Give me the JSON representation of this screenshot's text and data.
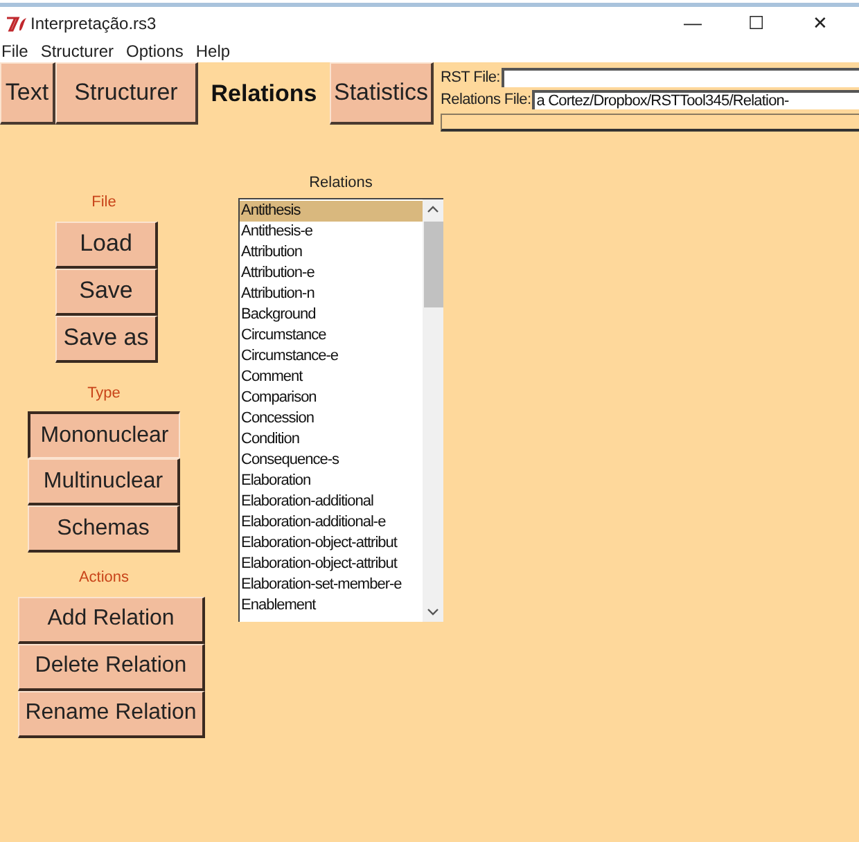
{
  "window": {
    "title": "Interpretação.rs3",
    "controls": [
      "—",
      "☐",
      "✕"
    ]
  },
  "menu": [
    "File",
    "Structurer",
    "Options",
    "Help"
  ],
  "tabs": [
    {
      "label": "Text",
      "selected": false
    },
    {
      "label": "Structurer",
      "selected": false
    },
    {
      "label": "Relations",
      "selected": true
    },
    {
      "label": "Statistics",
      "selected": false
    }
  ],
  "files": [
    {
      "label": "RST File:"
    },
    {
      "label": "Relations File:",
      "value": "a Cortez/Dropbox/RSTTool345/Relation-"
    }
  ],
  "groups": [
    {
      "title": "File",
      "buttons": [
        {
          "label": "Load",
          "selected": false
        },
        {
          "label": "Save",
          "selected": false
        },
        {
          "label": "Save as",
          "selected": false
        }
      ]
    },
    {
      "title": "Type",
      "buttons": [
        {
          "label": "Mononuclear",
          "selected": true
        },
        {
          "label": "Multinuclear",
          "selected": false
        },
        {
          "label": "Schemas",
          "selected": false
        }
      ]
    },
    {
      "title": "Actions",
      "buttons": [
        {
          "label": "Add Relation",
          "selected": false
        },
        {
          "label": "Delete Relation",
          "selected": false
        },
        {
          "label": "Rename Relation",
          "selected": false
        }
      ]
    }
  ],
  "relations": {
    "title": "Relations",
    "items": [
      {
        "label": "Antithesis",
        "selected": true
      },
      {
        "label": "Antithesis-e",
        "selected": false
      },
      {
        "label": "Attribution",
        "selected": false
      },
      {
        "label": "Attribution-e",
        "selected": false
      },
      {
        "label": "Attribution-n",
        "selected": false
      },
      {
        "label": "Background",
        "selected": false
      },
      {
        "label": "Circumstance",
        "selected": false
      },
      {
        "label": "Circumstance-e",
        "selected": false
      },
      {
        "label": "Comment",
        "selected": false
      },
      {
        "label": "Comparison",
        "selected": false
      },
      {
        "label": "Concession",
        "selected": false
      },
      {
        "label": "Condition",
        "selected": false
      },
      {
        "label": "Consequence-s",
        "selected": false
      },
      {
        "label": "Elaboration",
        "selected": false
      },
      {
        "label": "Elaboration-additional",
        "selected": false
      },
      {
        "label": "Elaboration-additional-e",
        "selected": false
      },
      {
        "label": "Elaboration-object-attribut",
        "selected": false
      },
      {
        "label": "Elaboration-object-attribut",
        "selected": false
      },
      {
        "label": "Elaboration-set-member-e",
        "selected": false
      },
      {
        "label": "Enablement",
        "selected": false
      }
    ]
  }
}
